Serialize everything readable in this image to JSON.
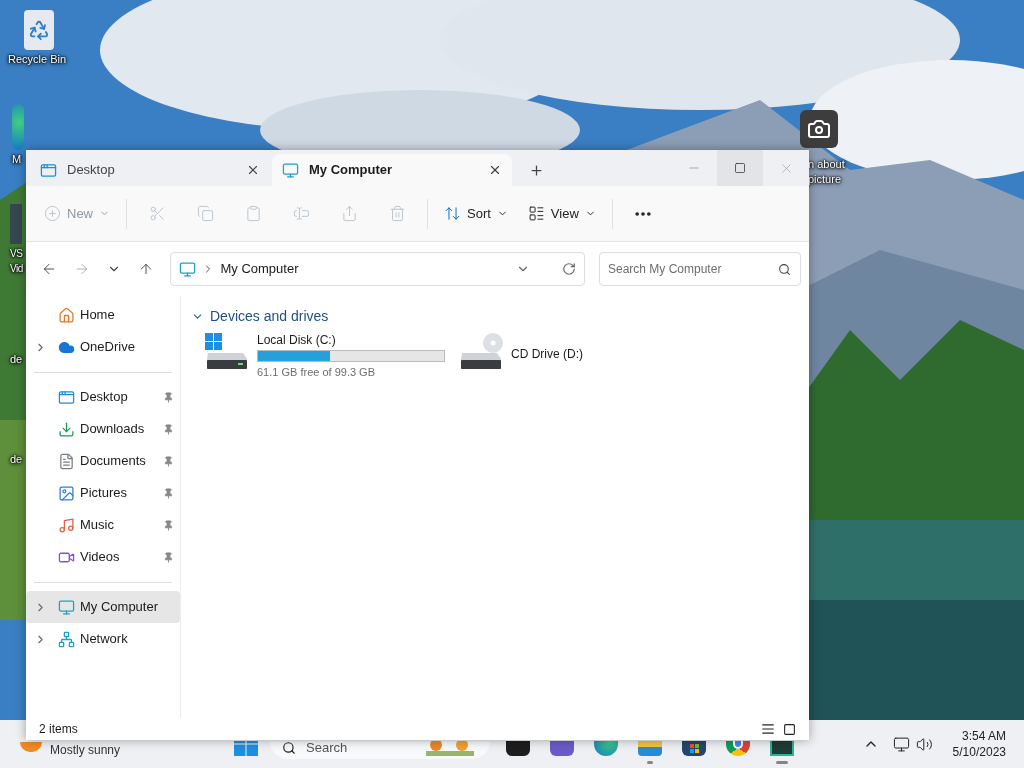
{
  "desktop_icons": [
    {
      "kind": "recycle",
      "lines": [
        "Recycle Bin"
      ]
    },
    {
      "kind": "edge",
      "lines": [
        "M"
      ]
    },
    {
      "kind": "video",
      "lines": [
        "VS",
        "Vid"
      ]
    },
    {
      "kind": "none",
      "lines": [
        "de"
      ]
    },
    {
      "kind": "none",
      "lines": [
        "de"
      ]
    },
    {
      "kind": "camera",
      "lines": [
        "n about",
        "picture"
      ]
    }
  ],
  "window": {
    "tabs": [
      {
        "label": "Desktop",
        "kind": "desktop",
        "selected": false
      },
      {
        "label": "My Computer",
        "kind": "computer",
        "selected": true
      }
    ],
    "toolbar": [
      {
        "kind": "new",
        "label": "New",
        "disabled": true
      },
      {
        "kind": "cut",
        "disabled": true
      },
      {
        "kind": "copy",
        "disabled": true
      },
      {
        "kind": "paste",
        "disabled": true
      },
      {
        "kind": "rename",
        "disabled": true
      },
      {
        "kind": "share",
        "disabled": true
      },
      {
        "kind": "delete",
        "disabled": true
      },
      {
        "kind": "sort",
        "label": "Sort",
        "disabled": false
      },
      {
        "kind": "view",
        "label": "View",
        "disabled": false
      },
      {
        "kind": "more",
        "disabled": false
      }
    ],
    "address": {
      "location": "My Computer"
    },
    "search": {
      "placeholder": "Search My Computer"
    },
    "sidebar": [
      [
        {
          "kind": "home",
          "label": "Home",
          "expandable": false,
          "pinned": false,
          "selected": false
        },
        {
          "kind": "onedrive",
          "label": "OneDrive",
          "expandable": true,
          "pinned": false,
          "selected": false
        }
      ],
      [
        {
          "kind": "desktop",
          "label": "Desktop",
          "expandable": false,
          "pinned": true,
          "selected": false
        },
        {
          "kind": "downloads",
          "label": "Downloads",
          "expandable": false,
          "pinned": true,
          "selected": false
        },
        {
          "kind": "documents",
          "label": "Documents",
          "expandable": false,
          "pinned": true,
          "selected": false
        },
        {
          "kind": "pictures",
          "label": "Pictures",
          "expandable": false,
          "pinned": true,
          "selected": false
        },
        {
          "kind": "music",
          "label": "Music",
          "expandable": false,
          "pinned": true,
          "selected": false
        },
        {
          "kind": "videos",
          "label": "Videos",
          "expandable": false,
          "pinned": true,
          "selected": false
        }
      ],
      [
        {
          "kind": "computer",
          "label": "My Computer",
          "expandable": true,
          "pinned": false,
          "selected": true
        },
        {
          "kind": "network",
          "label": "Network",
          "expandable": true,
          "pinned": false,
          "selected": false
        }
      ]
    ],
    "group": {
      "title": "Devices and drives",
      "expanded": true,
      "drives": [
        {
          "kind": "disk",
          "name": "Local Disk (C:)",
          "level": 0.385,
          "detail": "61.1 GB free of 99.3 GB"
        },
        {
          "kind": "cd",
          "name": "CD Drive (D:)"
        }
      ]
    },
    "status": "2 items"
  },
  "taskbar": {
    "weather": "Mostly sunny",
    "search": "Search",
    "apps": [
      {
        "kind": "terminal",
        "running": false
      },
      {
        "kind": "teams",
        "running": false
      },
      {
        "kind": "edge",
        "running": false
      },
      {
        "kind": "explorer",
        "running": true
      },
      {
        "kind": "store",
        "running": false
      },
      {
        "kind": "chrome",
        "running": false
      },
      {
        "kind": "media",
        "running": true
      }
    ],
    "time": "3:54 AM",
    "date": "5/10/2023"
  }
}
